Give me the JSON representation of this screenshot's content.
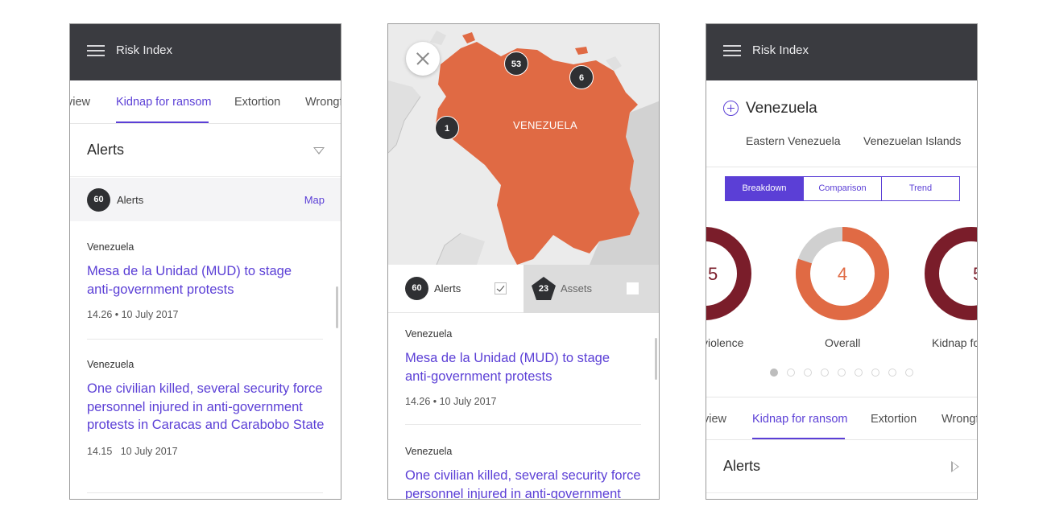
{
  "colors": {
    "accent": "#5b3fd6",
    "appbar": "#3a3b40",
    "map_country": "#e06a44",
    "donut_dark": "#7a1d2a",
    "donut_grey": "#d0d0d0"
  },
  "phone1": {
    "appbar": {
      "menu_icon": "hamburger-icon",
      "title": "Risk Index"
    },
    "tabs": [
      "view",
      "Kidnap for ransom",
      "Extortion",
      "Wrongf"
    ],
    "active_tab": "Kidnap for ransom",
    "section": {
      "title": "Alerts",
      "toggle_icon": "triangle-down-icon"
    },
    "count_bar": {
      "count": "60",
      "label": "Alerts",
      "link": "Map"
    },
    "alerts": [
      {
        "region": "Venezuela",
        "title": "Mesa de la Unidad (MUD) to stage anti-government protests",
        "meta": "14.26 • 10 July 2017"
      },
      {
        "region": "Venezuela",
        "title": "One civilian killed, several security force personnel injured in anti-government protests in Caracas and Carabobo State",
        "meta": "14.15   10 July 2017"
      }
    ]
  },
  "phone2": {
    "map": {
      "country_label": "VENEZUELA",
      "close_icon": "close-icon",
      "clusters": [
        "53",
        "6",
        "1"
      ]
    },
    "filters": [
      {
        "count": "60",
        "label": "Alerts",
        "checked": true
      },
      {
        "count": "23",
        "label": "Assets",
        "checked": false
      }
    ],
    "alerts": [
      {
        "region": "Venezuela",
        "title": "Mesa de la Unidad (MUD) to stage anti-government protests",
        "meta": "14.26 • 10 July 2017"
      },
      {
        "region": "Venezuela",
        "title": "One civilian killed, several security force personnel injured in anti-government",
        "meta": ""
      }
    ]
  },
  "phone3": {
    "appbar": {
      "menu_icon": "hamburger-icon",
      "title": "Risk Index"
    },
    "country": {
      "icon": "plus-circle-icon",
      "name": "Venezuela"
    },
    "subregions": [
      "Eastern Venezuela",
      "Venezuelan Islands"
    ],
    "segments": [
      "Breakdown",
      "Comparison",
      "Trend"
    ],
    "active_segment": "Breakdown",
    "donuts": [
      {
        "label": "violence",
        "value": "5",
        "fill": 1.0
      },
      {
        "label": "Overall",
        "value": "4",
        "fill": 0.8
      },
      {
        "label": "Kidnap fo",
        "value": "5",
        "fill": 1.0
      }
    ],
    "pagination": {
      "total": 9,
      "active": 1
    },
    "tabs": [
      "view",
      "Kidnap for ransom",
      "Extortion",
      "Wrongf"
    ],
    "active_tab": "Kidnap for ransom",
    "section": {
      "title": "Alerts",
      "toggle_icon": "triangle-right-icon"
    }
  }
}
